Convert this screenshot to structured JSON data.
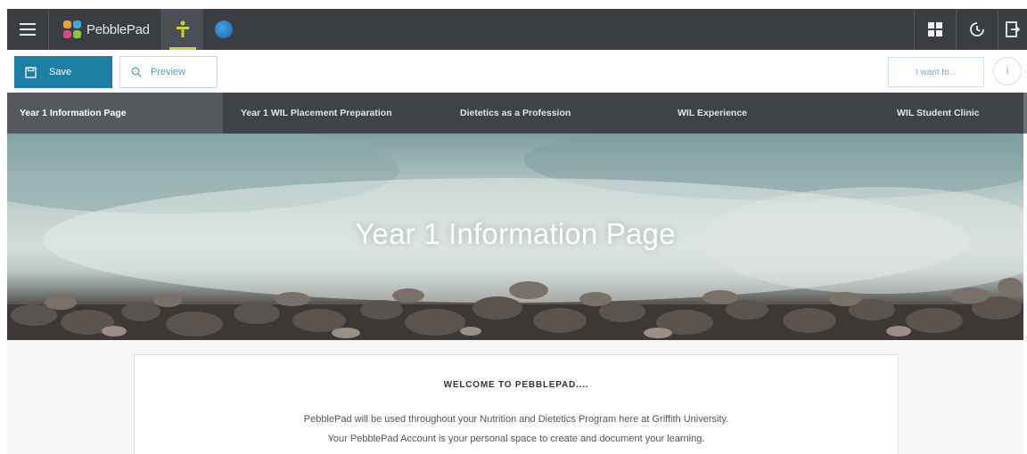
{
  "app": {
    "name": "PebblePad"
  },
  "toolbar": {
    "save_label": "Save",
    "preview_label": "Preview",
    "i_want_to_label": "I want to...",
    "info_label": "i"
  },
  "nav": {
    "tabs": [
      {
        "label": "Year 1 Information Page",
        "active": true
      },
      {
        "label": "Year 1 WIL Placement Preparation",
        "active": false
      },
      {
        "label": "Dietetics as a Profession",
        "active": false
      },
      {
        "label": "WIL Experience",
        "active": false
      },
      {
        "label": "WIL Student Clinic",
        "active": false
      }
    ]
  },
  "hero": {
    "title": "Year 1 Information Page"
  },
  "content": {
    "heading": "WELCOME TO PEBBLEPAD....",
    "paragraph_line1": "PebblePad will be used throughout your Nutrition and Dietetics Program here at Griffith University.",
    "paragraph_line2": "Your PebblePad Account is your personal space to create and document your learning."
  },
  "colors": {
    "topbar": "#3a3d42",
    "save_button": "#1b7ea3",
    "nav_bar": "#3f4247",
    "nav_active": "#55595e",
    "accent_lime": "#c7d431",
    "link_blue": "#6ab0cf"
  },
  "icons": {
    "menu": "hamburger-menu-icon",
    "logo": "pebblepad-logo-icon",
    "active_tool": "figure-icon",
    "globe": "globe-icon",
    "grid": "apps-grid-icon",
    "history": "history-icon",
    "logout": "logout-icon",
    "save": "save-icon",
    "preview": "search-icon"
  }
}
